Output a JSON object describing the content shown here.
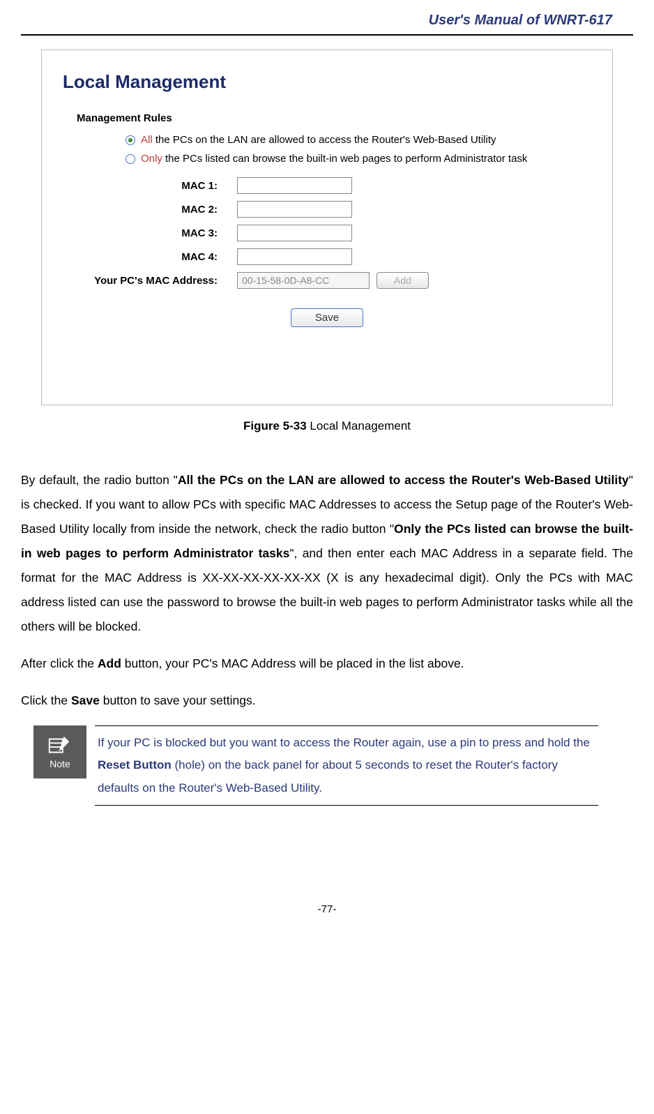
{
  "header": {
    "title": "User's Manual of WNRT-617"
  },
  "screenshot": {
    "title": "Local Management",
    "subtitle": "Management Rules",
    "radio1": {
      "prefix": "All",
      "rest": " the PCs on the LAN are allowed to access the Router's Web-Based Utility"
    },
    "radio2": {
      "prefix": "Only",
      "rest": " the PCs listed can browse the built-in web pages to perform Administrator task"
    },
    "mac1_label": "MAC 1:",
    "mac2_label": "MAC 2:",
    "mac3_label": "MAC 3:",
    "mac4_label": "MAC 4:",
    "pcmac_label": "Your PC's MAC Address:",
    "pcmac_value": "00-15-58-0D-A8-CC",
    "add_label": "Add",
    "save_label": "Save"
  },
  "figure": {
    "number": "Figure 5-33",
    "caption": " Local Management"
  },
  "para1": {
    "t1": "By default, the radio button \"",
    "b1": "All the PCs on the LAN are allowed to access the Router's Web-Based Utility",
    "t2": "\" is checked. If you want to allow PCs with specific MAC Addresses to access the Setup page of the Router's Web-Based Utility locally from inside the network, check the radio button \"",
    "b2": "Only the PCs listed can browse the built-in web pages to perform Administrator tasks",
    "t3": "\", and then enter each MAC Address in a separate field. The format for the MAC Address is XX-XX-XX-XX-XX-XX (X is any hexadecimal digit). Only the PCs with MAC address listed can use the password to browse the built-in web pages to perform Administrator tasks while all the others will be blocked."
  },
  "para2": {
    "t1": "After click the ",
    "b1": "Add",
    "t2": " button, your PC's MAC Address will be placed in the list above."
  },
  "para3": {
    "t1": "Click the ",
    "b1": "Save",
    "t2": " button to save your settings."
  },
  "note": {
    "label": "Note",
    "t1": "If your PC is blocked but you want to access the Router again, use a pin to press and hold the ",
    "b1": "Reset Button",
    "t2": " (hole) on the back panel for about 5 seconds to reset the Router's factory defaults on the Router's Web-Based Utility."
  },
  "page": "-77-"
}
